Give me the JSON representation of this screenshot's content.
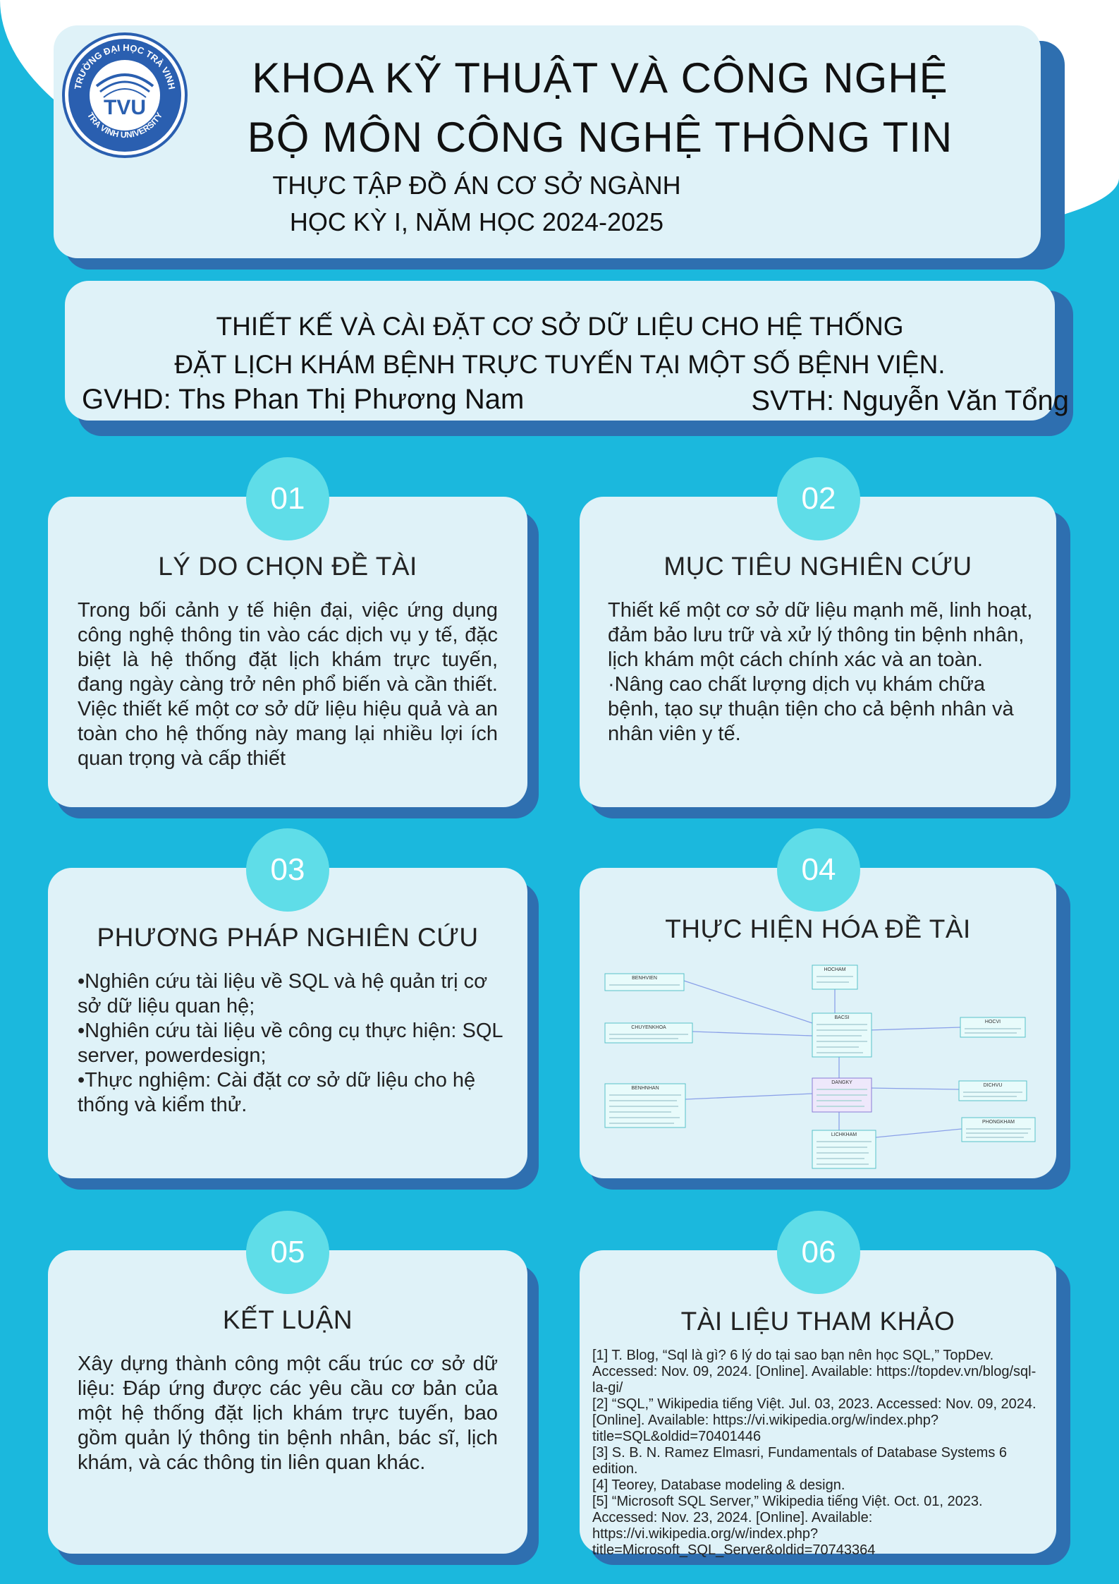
{
  "header": {
    "logo_text_top": "TRƯỜNG ĐẠI HỌC TRÀ VINH",
    "logo_text_bottom": "TRA VINH UNIVERSITY",
    "logo_mark": "TVU",
    "line1": "KHOA KỸ THUẬT VÀ CÔNG NGHỆ",
    "line2": "BỘ MÔN CÔNG NGHỆ THÔNG TIN",
    "line3": "THỰC TẬP ĐỒ ÁN CƠ SỞ NGÀNH",
    "line4": "HỌC KỲ I, NĂM HỌC 2024-2025"
  },
  "title_box": {
    "line1": "THIẾT KẾ VÀ CÀI ĐẶT CƠ SỞ DỮ LIỆU CHO HỆ THỐNG",
    "line2": "ĐẶT LỊCH KHÁM BỆNH TRỰC TUYẾN TẠI MỘT SỐ BỆNH VIỆN.",
    "gvhd": "GVHD:  Ths Phan Thị Phương Nam",
    "svth": "SVTH: Nguyễn Văn Tổng"
  },
  "sections": [
    {
      "number": "01",
      "title": "LÝ DO CHỌN ĐỀ TÀI",
      "body": "Trong bối cảnh y tế hiện đại, việc ứng dụng công nghệ thông tin vào các dịch vụ y tế, đặc biệt là hệ thống đặt lịch khám trực tuyến, đang ngày càng trở nên phổ biến và cần thiết. Việc thiết kế một cơ sở dữ liệu hiệu quả và an toàn cho hệ thống này mang lại nhiều lợi ích quan trọng và cấp thiết"
    },
    {
      "number": "02",
      "title": "MỤC TIÊU NGHIÊN CỨU",
      "body1": "Thiết kế một cơ sở dữ liệu mạnh mẽ, linh hoạt, đảm bảo lưu trữ và xử lý thông tin bệnh nhân, lịch khám một cách chính xác và an toàn.",
      "body2": "·Nâng cao chất lượng dịch vụ khám chữa bệnh, tạo sự thuận tiện cho cả bệnh nhân và nhân viên y tế."
    },
    {
      "number": "03",
      "title": "PHƯƠNG PHÁP NGHIÊN CỨU",
      "items": [
        "•Nghiên cứu tài liệu về SQL và hệ quản trị cơ sở dữ liệu quan hệ;",
        "•Nghiên cứu tài liệu về công cụ thực hiện: SQL server, powerdesign;",
        "•Thực nghiệm: Cài đặt cơ sở dữ liệu cho hệ thống và kiểm thử."
      ]
    },
    {
      "number": "04",
      "title": "THỰC HIỆN HÓA ĐỀ TÀI",
      "erd_tables": [
        "HOCHAM",
        "BENHVIEN",
        "CHUYENKHOA",
        "BACSI",
        "HOCVI",
        "DANGKY",
        "DICHVU",
        "BENHNHAN",
        "PHONGKHAM",
        "LICHKHAM"
      ]
    },
    {
      "number": "05",
      "title": "KẾT LUẬN",
      "body": "Xây dựng thành công một cấu trúc cơ sở dữ liệu: Đáp ứng được các yêu cầu cơ bản của một hệ thống đặt lịch khám trực tuyến, bao gồm quản lý thông tin bệnh nhân, bác sĩ, lịch khám, và các thông tin liên quan khác."
    },
    {
      "number": "06",
      "title": "TÀI LIỆU THAM KHẢO",
      "refs": [
        "[1]     T. Blog, “Sql là gì? 6 lý do tại sao bạn nên học SQL,” TopDev. Accessed: Nov. 09, 2024. [Online]. Available: https://topdev.vn/blog/sql-la-gi/",
        "[2]     “SQL,” Wikipedia tiếng Việt. Jul. 03, 2023. Accessed: Nov. 09, 2024. [Online]. Available: https://vi.wikipedia.org/w/index.php?title=SQL&oldid=70401446",
        "[3]     S. B. N. Ramez Elmasri, Fundamentals of Database Systems 6 edition.",
        "[4]     Teorey, Database modeling & design.",
        "[5]     “Microsoft SQL Server,” Wikipedia tiếng Việt. Oct. 01, 2023. Accessed: Nov. 23, 2024. [Online]. Available: https://vi.wikipedia.org/w/index.php?title=Microsoft_SQL_Server&oldid=70743364"
      ]
    }
  ]
}
